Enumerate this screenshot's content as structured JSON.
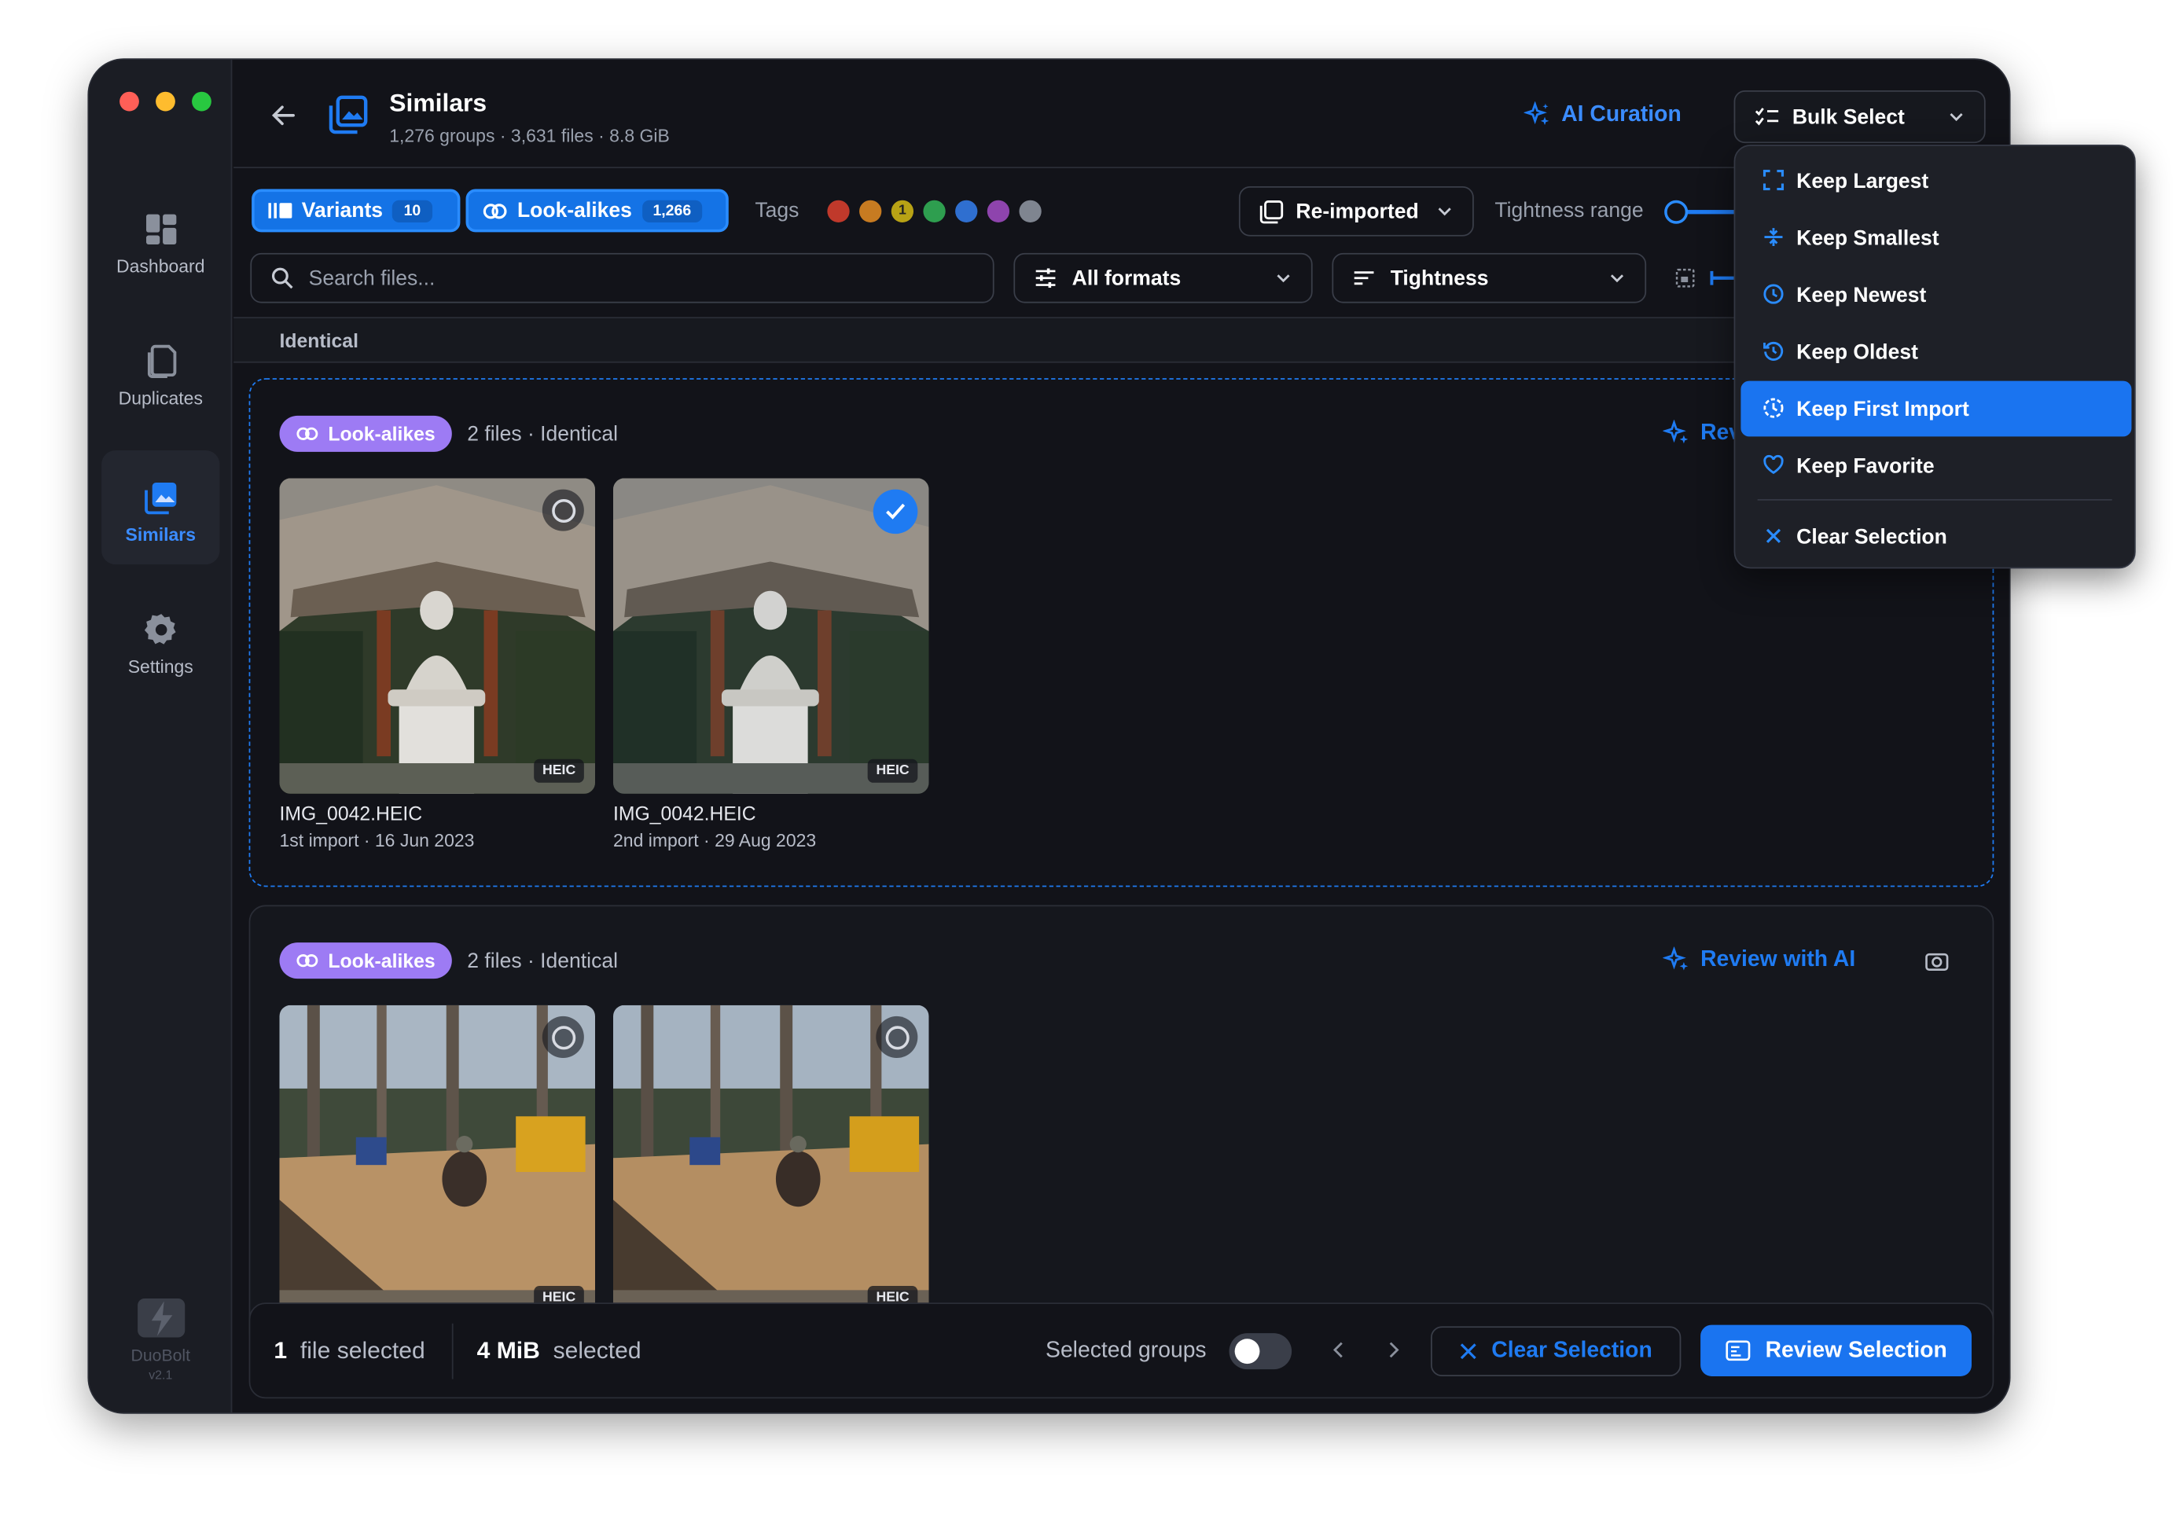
{
  "app": {
    "brand": "DuoBolt",
    "version": "v2.1"
  },
  "nav": [
    {
      "label": "Dashboard",
      "icon": "dashboard-icon"
    },
    {
      "label": "Duplicates",
      "icon": "duplicates-icon"
    },
    {
      "label": "Similars",
      "icon": "similars-icon",
      "active": true
    },
    {
      "label": "Settings",
      "icon": "gear-icon"
    }
  ],
  "header": {
    "title": "Similars",
    "subtitle": "1,276 groups · 3,631 files · 8.8 GiB",
    "ai_curation": "AI Curation",
    "bulk_select": "Bulk Select"
  },
  "filters": {
    "variants": {
      "label": "Variants",
      "count": "10"
    },
    "lookalikes": {
      "label": "Look-alikes",
      "count": "1,266"
    },
    "tags_label": "Tags",
    "tags": [
      {
        "color": "#c0392b",
        "text": ""
      },
      {
        "color": "#c77b21",
        "text": ""
      },
      {
        "color": "#b8a215",
        "text": "1"
      },
      {
        "color": "#2e9e4f",
        "text": ""
      },
      {
        "color": "#2f6fd0",
        "text": ""
      },
      {
        "color": "#8e44ad",
        "text": ""
      },
      {
        "color": "#7f8590",
        "text": ""
      }
    ],
    "reimported": "Re-imported",
    "tightness_range": "Tightness range",
    "search_placeholder": "Search files...",
    "formats": "All formats",
    "tightness": "Tightness"
  },
  "section": {
    "title": "Identical"
  },
  "groups": [
    {
      "badge": "Look-alikes",
      "meta": "2 files · Identical",
      "review_ai": "Review with AI",
      "files": [
        {
          "name": "IMG_0042.HEIC",
          "sub": "1st import · 16 Jun 2023",
          "format": "HEIC",
          "selected": false
        },
        {
          "name": "IMG_0042.HEIC",
          "sub": "2nd import · 29 Aug 2023",
          "format": "HEIC",
          "selected": true
        }
      ]
    },
    {
      "badge": "Look-alikes",
      "meta": "2 files · Identical",
      "review_ai": "Review with AI",
      "files": [
        {
          "name": "",
          "sub": "",
          "format": "HEIC",
          "selected": false
        },
        {
          "name": "",
          "sub": "",
          "format": "HEIC",
          "selected": false
        }
      ]
    }
  ],
  "bulk_menu": {
    "items": [
      "Keep Largest",
      "Keep Smallest",
      "Keep Newest",
      "Keep Oldest",
      "Keep First Import",
      "Keep Favorite"
    ],
    "highlighted": "Keep First Import",
    "clear": "Clear Selection"
  },
  "bottom": {
    "files_count": "1",
    "files_label": "file selected",
    "size_value": "4 MiB",
    "size_label": "selected",
    "selected_groups": "Selected groups",
    "clear_selection": "Clear Selection",
    "review_selection": "Review Selection"
  },
  "colors": {
    "accent": "#1f7bf2",
    "badge": "#9d7bf4",
    "background": "#121319"
  }
}
